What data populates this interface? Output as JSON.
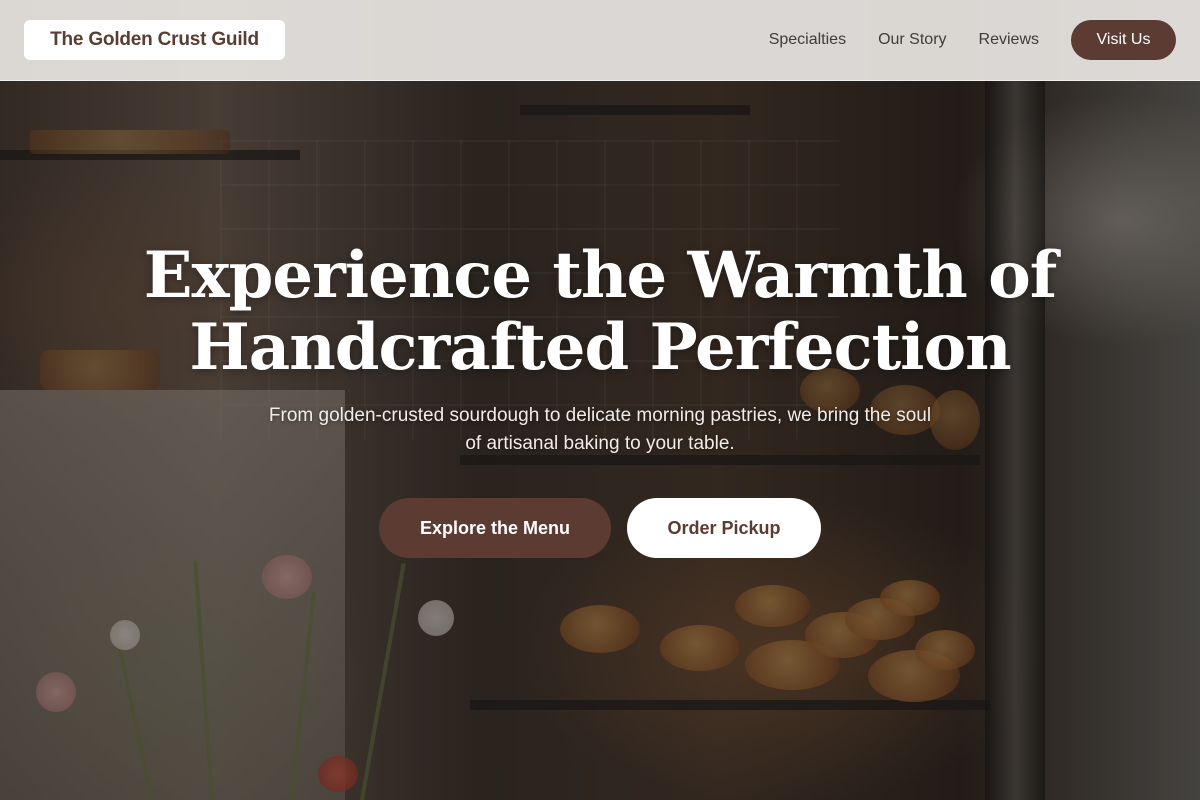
{
  "header": {
    "brand": "The Golden Crust Guild",
    "nav": [
      {
        "label": "Specialties"
      },
      {
        "label": "Our Story"
      },
      {
        "label": "Reviews"
      }
    ],
    "cta_label": "Visit Us"
  },
  "hero": {
    "title_line1": "Experience the Warmth of",
    "title_line2": "Handcrafted Perfection",
    "subtitle": "From golden-crusted sourdough to delicate morning pastries, we bring the soul of artisanal baking to your table.",
    "primary_button": "Explore the Menu",
    "secondary_button": "Order Pickup"
  },
  "colors": {
    "brand_brown": "#5b3b32",
    "header_bg": "#e8e5e2",
    "white": "#ffffff"
  }
}
